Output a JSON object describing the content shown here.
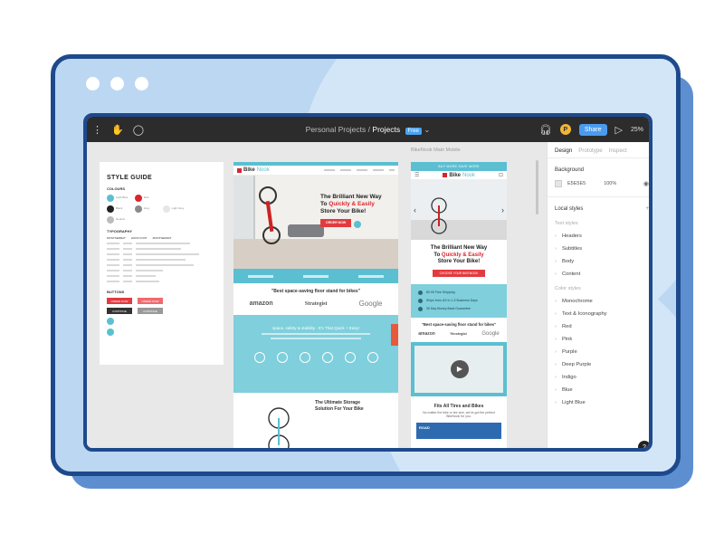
{
  "window": {
    "controls": [
      "dot",
      "dot",
      "dot"
    ]
  },
  "toolbar": {
    "breadcrumb_project": "Personal Projects",
    "breadcrumb_separator": "/",
    "breadcrumb_current": "Projects",
    "badge": "Free",
    "avatar_initial": "P",
    "share_label": "Share",
    "zoom": "25%",
    "icons": [
      "menu-icon",
      "hand-icon",
      "comment-icon",
      "headphones-icon",
      "play-icon",
      "chevron-down-icon"
    ]
  },
  "style_guide": {
    "title": "STYLE GUIDE",
    "colours_label": "COLOURS",
    "typography_label": "TYPOGRAPHY",
    "font_names": [
      "MONTSERRAT",
      "HOOK FONT",
      "MONTSERRAT"
    ],
    "buttons_label": "BUTTONS",
    "button_primary": "ORDER NOW",
    "button_secondary": "ORDER NOW",
    "button_dark": "CONTINUE",
    "button_grey": "CONTINUE",
    "swatches": [
      {
        "color": "#5bbfd1",
        "name": "Light Blue"
      },
      {
        "color": "#d8262f",
        "name": "Red"
      },
      {
        "color": "#222222",
        "name": "Black"
      },
      {
        "color": "#8a8a8a",
        "name": "Grey"
      },
      {
        "color": "#e6e6e6",
        "name": "Light Grey"
      },
      {
        "color": "#bdbdbd",
        "name": "Neutral"
      }
    ]
  },
  "desktop_mock": {
    "logo_text": "Bike",
    "logo_accent": "Nook",
    "hero_line1": "The Brilliant New Way",
    "hero_line2": "To ",
    "hero_highlight": "Quickly & Easily",
    "hero_line3": "Store Your Bike!",
    "hero_button": "ORDER NOW",
    "quote": "\"Best space-saving floor stand for bikes\"",
    "brands": [
      "amazon",
      "Strategist",
      "Google"
    ],
    "teal_title": "space, safety & stability - It's That Quick + Easy!",
    "bottom_title_1": "The Ultimate Storage",
    "bottom_title_2": "Solution For Your Bike"
  },
  "mobile_mock": {
    "label": "BikeNook Main Mobile",
    "top_banner": "BUY MORE SAVE MORE",
    "logo_text": "Bike",
    "logo_accent": "Nook",
    "headline_1": "The Brilliant New Way",
    "headline_2": "To ",
    "headline_highlight": "Quickly & Easily",
    "headline_3": "Store Your Bike!",
    "button": "CHOOSE YOUR BIKENOOK",
    "features": [
      "$9.99 Free Shipping",
      "Ships from US In 1-3 Business Days",
      "30 Day Money Back Guarantee"
    ],
    "quote": "\"Best space-saving floor stand for bikes\"",
    "brands": [
      "amazon",
      "Strategist",
      "Google"
    ],
    "fit_title": "Fits All Tires and Bikes",
    "fit_sub": "No matter the bike or tire size, we've got the perfect BikeNook for you.",
    "road_label": "ROAD"
  },
  "panel": {
    "tabs": [
      "Design",
      "Prototype",
      "Inspect"
    ],
    "background_label": "Background",
    "background_hex": "E5E5E5",
    "background_opacity": "100%",
    "local_styles_label": "Local styles",
    "add_symbol": "+",
    "text_styles_label": "Text styles",
    "text_styles": [
      "Headers",
      "Subtitles",
      "Body",
      "Content"
    ],
    "color_styles_label": "Color styles",
    "color_styles": [
      "Monochrome",
      "Text & Iconography",
      "Red",
      "Pink",
      "Purple",
      "Deep Purple",
      "Indigo",
      "Blue",
      "Light Blue"
    ],
    "help": "?"
  }
}
